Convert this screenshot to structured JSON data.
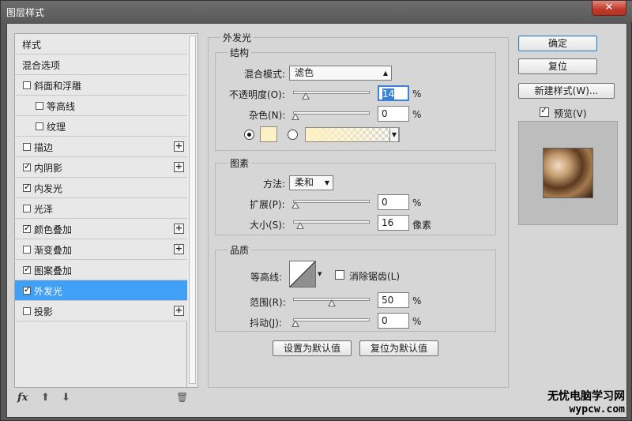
{
  "window": {
    "title": "图层样式",
    "close_glyph": "✕"
  },
  "style_list": {
    "items": [
      {
        "label": "样式",
        "checkbox": false,
        "checked": false,
        "plus": false,
        "selected": false,
        "indent": 0
      },
      {
        "label": "混合选项",
        "checkbox": false,
        "checked": false,
        "plus": false,
        "selected": false,
        "indent": 0
      },
      {
        "label": "斜面和浮雕",
        "checkbox": true,
        "checked": false,
        "plus": false,
        "selected": false,
        "indent": 0
      },
      {
        "label": "等高线",
        "checkbox": true,
        "checked": false,
        "plus": false,
        "selected": false,
        "indent": 1
      },
      {
        "label": "纹理",
        "checkbox": true,
        "checked": false,
        "plus": false,
        "selected": false,
        "indent": 1
      },
      {
        "label": "描边",
        "checkbox": true,
        "checked": false,
        "plus": true,
        "selected": false,
        "indent": 0
      },
      {
        "label": "内阴影",
        "checkbox": true,
        "checked": true,
        "plus": true,
        "selected": false,
        "indent": 0
      },
      {
        "label": "内发光",
        "checkbox": true,
        "checked": true,
        "plus": false,
        "selected": false,
        "indent": 0
      },
      {
        "label": "光泽",
        "checkbox": true,
        "checked": false,
        "plus": false,
        "selected": false,
        "indent": 0
      },
      {
        "label": "颜色叠加",
        "checkbox": true,
        "checked": true,
        "plus": true,
        "selected": false,
        "indent": 0
      },
      {
        "label": "渐变叠加",
        "checkbox": true,
        "checked": false,
        "plus": true,
        "selected": false,
        "indent": 0
      },
      {
        "label": "图案叠加",
        "checkbox": true,
        "checked": true,
        "plus": false,
        "selected": false,
        "indent": 0
      },
      {
        "label": "外发光",
        "checkbox": true,
        "checked": true,
        "plus": false,
        "selected": true,
        "indent": 0
      },
      {
        "label": "投影",
        "checkbox": true,
        "checked": false,
        "plus": true,
        "selected": false,
        "indent": 0
      }
    ],
    "plus_glyph": "+",
    "check_glyph": "✓",
    "footer": {
      "fx": "fx",
      "up": "⬆",
      "down": "⬇",
      "trash": "🗑"
    }
  },
  "outer_glow": {
    "section_title": "外发光",
    "structure": {
      "title": "结构",
      "blend_mode_label": "混合模式:",
      "blend_mode_value": "滤色",
      "opacity_label": "不透明度(O):",
      "opacity_value": "14",
      "noise_label": "杂色(N):",
      "noise_value": "0",
      "percent": "%",
      "color_mode": "solid",
      "glow_color": "#fdf1c4"
    },
    "elements": {
      "title": "图素",
      "method_label": "方法:",
      "method_value": "柔和",
      "spread_label": "扩展(P):",
      "spread_value": "0",
      "size_label": "大小(S):",
      "size_value": "16",
      "size_unit": "像素",
      "percent": "%"
    },
    "quality": {
      "title": "品质",
      "contour_label": "等高线:",
      "antialias_label": "消除锯齿(L)",
      "antialias_checked": false,
      "range_label": "范围(R):",
      "range_value": "50",
      "jitter_label": "抖动(J):",
      "jitter_value": "0",
      "percent": "%"
    },
    "set_default_label": "设置为默认值",
    "reset_default_label": "复位为默认值"
  },
  "slider_levels": {
    "opacity": 0.14,
    "noise": 0.0,
    "spread": 0.0,
    "size": 0.064,
    "range": 0.5,
    "jitter": 0.0
  },
  "buttons": {
    "ok": "确定",
    "reset": "复位",
    "new_style": "新建样式(W)...",
    "preview_label": "预览(V)",
    "preview_checked": true
  },
  "watermark": {
    "line1": "无忧电脑学习网",
    "line2": "wypcw.com"
  },
  "colors": {
    "selected": "#3fa0f5",
    "focus": "#3b82d6"
  }
}
